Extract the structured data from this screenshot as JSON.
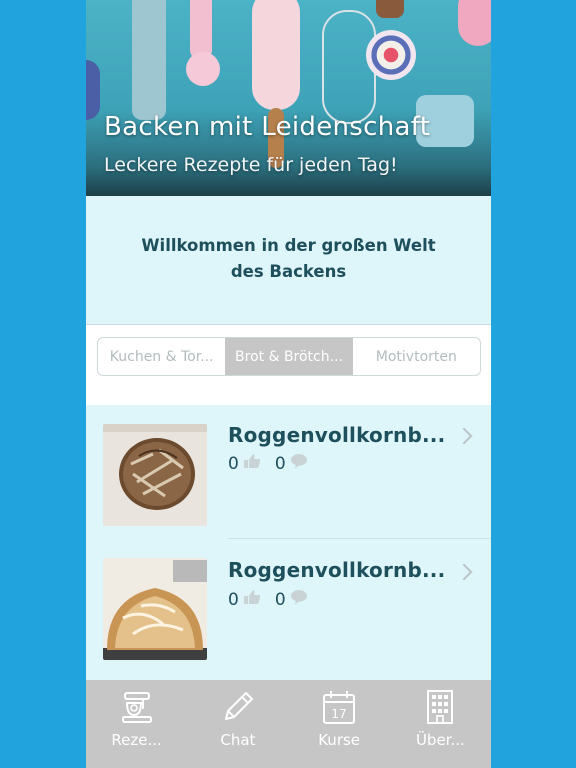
{
  "header": {
    "title": "Backen mit Leidenschaft",
    "subtitle": "Leckere Rezepte für jeden Tag!"
  },
  "welcome": {
    "line1": "Willkommen in der großen Welt",
    "line2": "des Backens"
  },
  "segments": [
    {
      "label": "Kuchen & Tor...",
      "selected": false
    },
    {
      "label": "Brot & Brötch...",
      "selected": true
    },
    {
      "label": "Motivtorten",
      "selected": false
    }
  ],
  "recipes": [
    {
      "title": "Roggenvollkornb...",
      "likes": "0",
      "comments": "0"
    },
    {
      "title": "Roggenvollkornb...",
      "likes": "0",
      "comments": "0"
    }
  ],
  "tabs": [
    {
      "label": "Reze...",
      "icon": "mixer-icon"
    },
    {
      "label": "Chat",
      "icon": "pencil-icon"
    },
    {
      "label": "Kurse",
      "icon": "calendar-icon"
    },
    {
      "label": "Über...",
      "icon": "building-icon"
    }
  ],
  "calendar_day": "17",
  "colors": {
    "background": "#21a3de",
    "app_background": "#def6f9",
    "text_primary": "#1e4f5c",
    "tabbar": "#c6c6c6",
    "segment_active": "#c6c6c6"
  }
}
